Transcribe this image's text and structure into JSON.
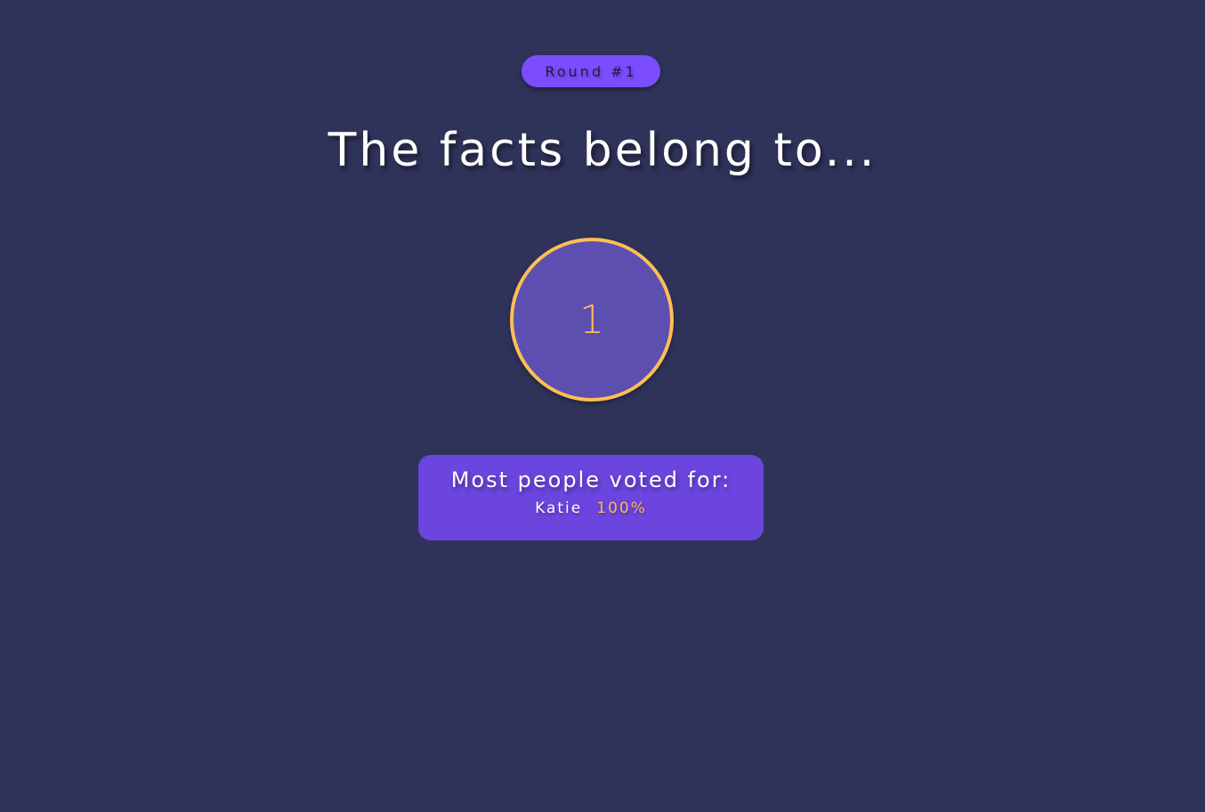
{
  "round": {
    "label": "Round #1"
  },
  "title": "The facts belong to...",
  "counter": {
    "value": "1"
  },
  "vote": {
    "heading": "Most people voted for:",
    "name": "Katie",
    "percent": "100%"
  },
  "colors": {
    "background": "#2f335a",
    "badge": "#7b4dff",
    "circle_fill": "#5c4faf",
    "accent": "#ffbe55",
    "card": "#6b45dd"
  }
}
